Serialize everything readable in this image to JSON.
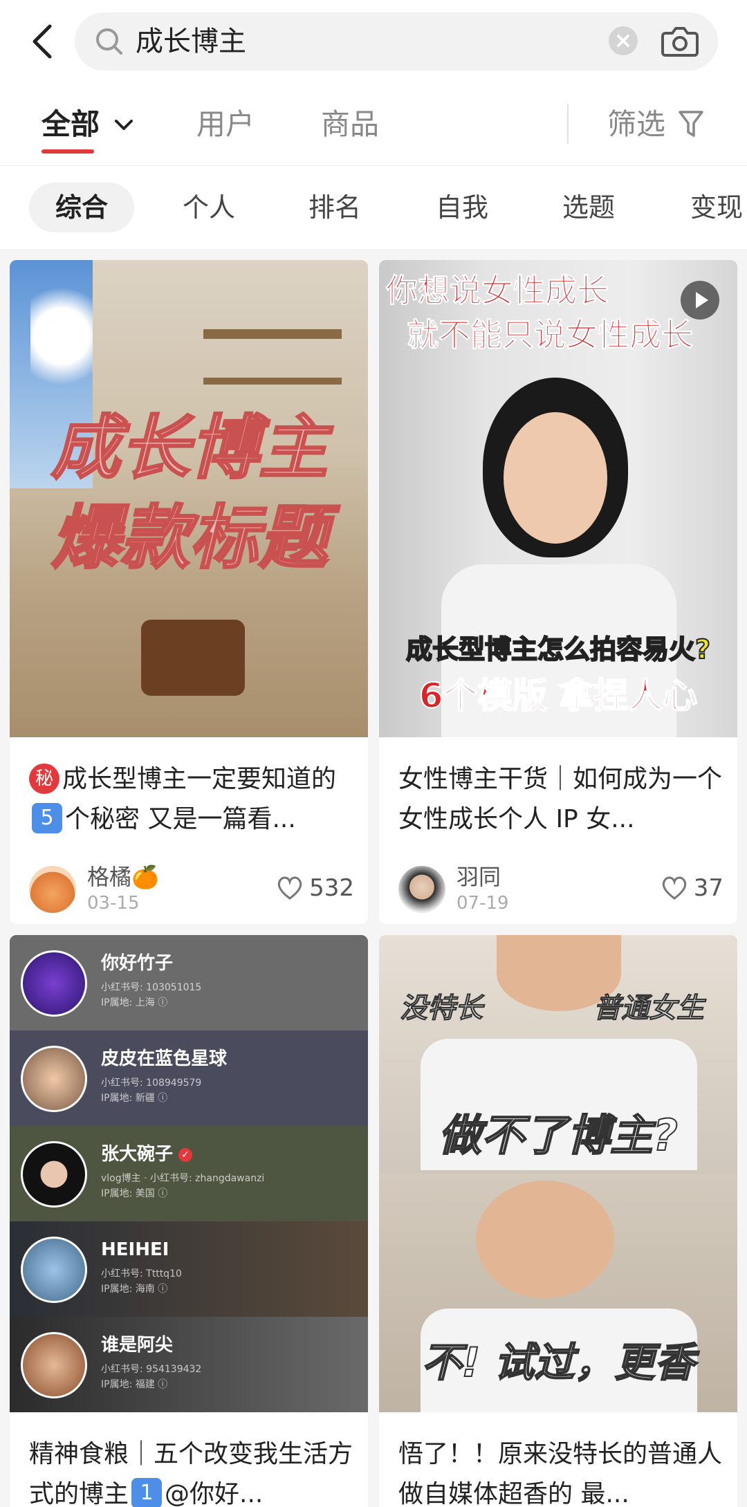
{
  "search": {
    "query": "成长博主"
  },
  "tabs": [
    {
      "label": "全部"
    },
    {
      "label": "用户"
    },
    {
      "label": "商品"
    }
  ],
  "filter_label": "筛选",
  "chips": [
    "综合",
    "个人",
    "排名",
    "自我",
    "选题",
    "变现"
  ],
  "colors": {
    "accent": "#e4393c",
    "pill": "#f1f1f1",
    "feed_bg": "#f5f5f5"
  },
  "cards": [
    {
      "cover_lines": [
        "成长博主",
        "爆款标题"
      ],
      "title_badge": "秘",
      "title_a": "成长型博主一定要知道的",
      "title_num": "5",
      "title_b": "个秘密 又是一篇看...",
      "author": "格橘🍊",
      "date": "03-15",
      "likes": "532"
    },
    {
      "cover_top": [
        "你想说女性成长",
        "就不能只说女性成长"
      ],
      "cover_bottom": [
        "成长型博主怎么拍容易火?",
        "6个模版 拿捏人心"
      ],
      "title": "女性博主干货｜如何成为一个女性成长个人 IP 女...",
      "author": "羽同",
      "date": "07-19",
      "likes": "37"
    },
    {
      "list": [
        {
          "name": "你好竹子",
          "meta1": "小红书号: 103051015",
          "meta2": "IP属地: 上海 ⓘ"
        },
        {
          "name": "皮皮在蓝色星球",
          "meta1": "小红书号: 108949579",
          "meta2": "IP属地: 新疆 ⓘ"
        },
        {
          "name": "张大碗子",
          "meta1": "vlog博主 · 小红书号: zhangdawanzi",
          "meta2": "IP属地: 美国 ⓘ"
        },
        {
          "name": "HEIHEI",
          "meta1": "小红书号: Ttttq10",
          "meta2": "IP属地: 海南 ⓘ"
        },
        {
          "name": "谁是阿尖",
          "meta1": "小红书号: 954139432",
          "meta2": "IP属地: 福建 ⓘ"
        }
      ],
      "title_a": "精神食粮｜五个改变我生活方式的博主",
      "title_num": "1",
      "title_b": "@你好..."
    },
    {
      "cover_tags": [
        "没特长",
        "普通女生"
      ],
      "cover_mid": "做不了博主?",
      "cover_bottom": "不! 试过，更香",
      "title": "悟了！！原来没特长的普通人做自媒体超香的 最..."
    }
  ]
}
